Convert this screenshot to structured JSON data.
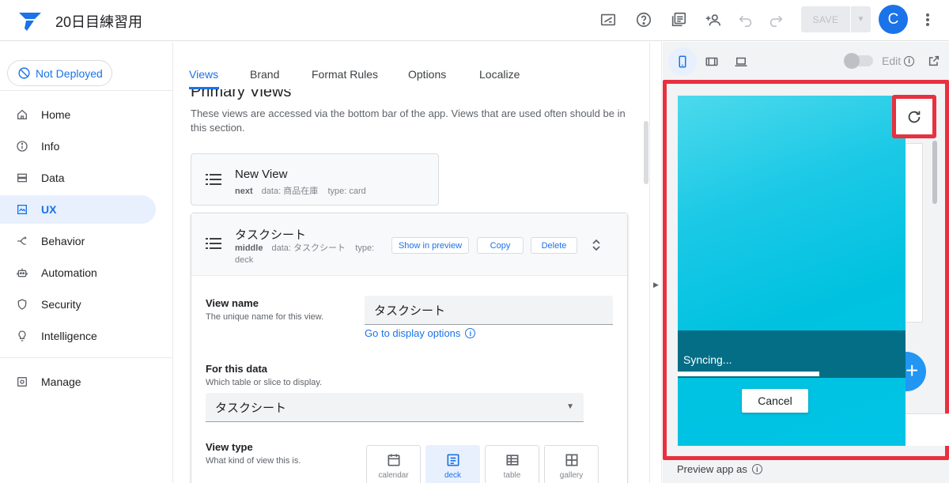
{
  "app": {
    "title": "20日目練習用"
  },
  "toolbar": {
    "save_label": "SAVE",
    "avatar_letter": "C"
  },
  "sidebar": {
    "deploy_status": "Not Deployed",
    "items": [
      {
        "label": "Home",
        "icon": "home-icon"
      },
      {
        "label": "Info",
        "icon": "info-icon"
      },
      {
        "label": "Data",
        "icon": "data-icon"
      },
      {
        "label": "UX",
        "icon": "ux-icon",
        "active": true
      },
      {
        "label": "Behavior",
        "icon": "behavior-icon"
      },
      {
        "label": "Automation",
        "icon": "automation-icon"
      },
      {
        "label": "Security",
        "icon": "security-icon"
      },
      {
        "label": "Intelligence",
        "icon": "lightbulb-icon"
      }
    ],
    "manage": {
      "label": "Manage",
      "icon": "manage-icon"
    }
  },
  "tabs": [
    {
      "label": "Views",
      "active": true
    },
    {
      "label": "Brand"
    },
    {
      "label": "Format Rules"
    },
    {
      "label": "Options"
    },
    {
      "label": "Localize"
    }
  ],
  "primary_views": {
    "title": "Primary Views",
    "description": "These views are accessed via the bottom bar of the app. Views that are used often should be in this section."
  },
  "views": [
    {
      "name": "New View",
      "position": "next",
      "data_label": "data:",
      "data": "商品在庫",
      "type_label": "type:",
      "type": "card"
    },
    {
      "name": "タスクシート",
      "position": "middle",
      "data_label": "data:",
      "data": "タスクシート",
      "type_label": "type:",
      "type": "deck",
      "actions": {
        "show_in_preview": "Show in preview",
        "copy": "Copy",
        "delete": "Delete"
      }
    }
  ],
  "form": {
    "view_name": {
      "label": "View name",
      "help": "The unique name for this view.",
      "value": "タスクシート",
      "link": "Go to display options"
    },
    "for_this_data": {
      "label": "For this data",
      "help": "Which table or slice to display.",
      "value": "タスクシート"
    },
    "view_type": {
      "label": "View type",
      "help": "What kind of view this is.",
      "options": [
        {
          "label": "calendar",
          "icon": "calendar-icon"
        },
        {
          "label": "deck",
          "icon": "deck-icon",
          "selected": true
        },
        {
          "label": "table",
          "icon": "table-icon"
        },
        {
          "label": "gallery",
          "icon": "gallery-icon"
        }
      ]
    }
  },
  "preview": {
    "edit_label": "Edit",
    "syncing_text": "Syncing...",
    "sync_progress": 0.62,
    "cancel_label": "Cancel",
    "preview_as_label": "Preview app as",
    "fab_symbol": "+"
  },
  "colors": {
    "accent": "#1a73e8",
    "highlight": "#e8303f",
    "sync_band": "#046e86",
    "phone_bg": "#00c2e0"
  }
}
